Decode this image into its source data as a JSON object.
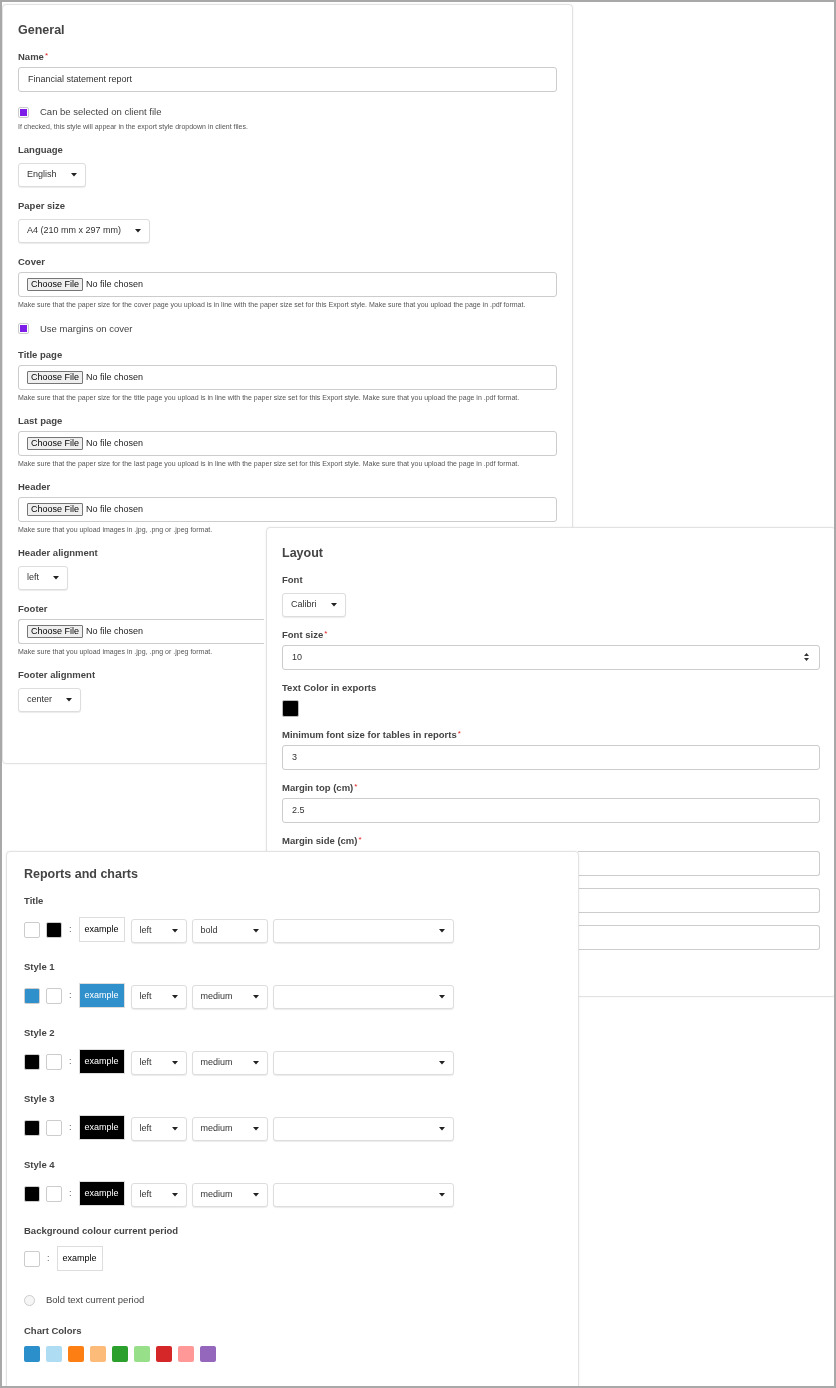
{
  "general": {
    "title": "General",
    "fields": [
      {
        "kind": "text",
        "label": "Name",
        "marker": "*",
        "value": "Financial statement report"
      },
      {
        "kind": "checkbox",
        "label": "Can be selected on client file",
        "checked": true,
        "help": "If checked, this style will appear in the export style dropdown in client files."
      },
      {
        "kind": "select",
        "label": "Language",
        "value": "English"
      },
      {
        "kind": "select",
        "label": "Paper size",
        "value": "A4 (210 mm x 297 mm)"
      },
      {
        "kind": "file",
        "label": "Cover",
        "button": "Choose File",
        "status": "No file chosen",
        "help": "Make sure that the paper size for the cover page you upload is in line with the paper size set for this Export style. Make sure that you upload the page in .pdf format."
      },
      {
        "kind": "checkbox",
        "label": "Use margins on cover",
        "checked": true
      },
      {
        "kind": "file",
        "label": "Title page",
        "button": "Choose File",
        "status": "No file chosen",
        "help": "Make sure that the paper size for the title page you upload is in line with the paper size set for this Export style. Make sure that you upload the page in .pdf format."
      },
      {
        "kind": "file",
        "label": "Last page",
        "button": "Choose File",
        "status": "No file chosen",
        "help": "Make sure that the paper size for the last page you upload is in line with the paper size set for this Export style. Make sure that you upload the page in .pdf format."
      },
      {
        "kind": "file",
        "label": "Header",
        "button": "Choose File",
        "status": "No file chosen",
        "help": "Make sure that you upload images in .jpg, .png or .jpeg format."
      },
      {
        "kind": "select",
        "label": "Header alignment",
        "value": "left"
      },
      {
        "kind": "file",
        "label": "Footer",
        "button": "Choose File",
        "status": "No file chosen",
        "help": "Make sure that you upload images in .jpg, .png or .jpeg format."
      },
      {
        "kind": "select",
        "label": "Footer alignment",
        "value": "center"
      }
    ]
  },
  "layout": {
    "title": "Layout",
    "fields": [
      {
        "kind": "select",
        "label": "Font",
        "value": "Calibri"
      },
      {
        "kind": "number",
        "label": "Font size",
        "marker": "*",
        "value": "10"
      },
      {
        "kind": "color",
        "label": "Text Color in exports",
        "color": "#000000"
      },
      {
        "kind": "text",
        "label": "Minimum font size for tables in reports",
        "marker": "*",
        "value": "3"
      },
      {
        "kind": "text",
        "label": "Margin top (cm)",
        "marker": "*",
        "value": "2.5"
      },
      {
        "kind": "text",
        "label": "Margin side (cm)",
        "marker": "*"
      },
      {
        "kind": "text"
      },
      {
        "kind": "text"
      }
    ]
  },
  "reports": {
    "title": "Reports and charts",
    "rows": [
      {
        "kind": "style",
        "label": "Title",
        "swatches": [
          {
            "color": "#ffffff"
          },
          {
            "color": "#000000"
          }
        ],
        "separator": ":",
        "example": "example",
        "align": "left",
        "weight": "bold"
      },
      {
        "kind": "style",
        "label": "Style 1",
        "swatches": [
          {
            "color": "#3090cb"
          },
          {
            "color": "#ffffff"
          }
        ],
        "separator": ":",
        "example": "example",
        "align": "left",
        "weight": "medium"
      },
      {
        "kind": "style",
        "label": "Style 2",
        "swatches": [
          {
            "color": "#000000"
          },
          {
            "color": "#ffffff"
          }
        ],
        "separator": ":",
        "example": "example",
        "align": "left",
        "weight": "medium"
      },
      {
        "kind": "style",
        "label": "Style 3",
        "swatches": [
          {
            "color": "#000000"
          },
          {
            "color": "#ffffff"
          }
        ],
        "separator": ":",
        "example": "example",
        "align": "left",
        "weight": "medium"
      },
      {
        "kind": "style",
        "label": "Style 4",
        "swatches": [
          {
            "color": "#000000"
          },
          {
            "color": "#ffffff"
          }
        ],
        "separator": ":",
        "example": "example",
        "align": "left",
        "weight": "medium"
      },
      {
        "kind": "background",
        "label": "Background colour current period",
        "swatches": [
          {
            "color": "#ffffff"
          }
        ],
        "separator": ":",
        "example": "example"
      },
      {
        "kind": "checkbox",
        "label": "Bold text current period",
        "checked": false
      },
      {
        "kind": "palette",
        "label": "Chart Colors",
        "colors": [
          {
            "color": "#2b8fcb"
          },
          {
            "color": "#aedcf2"
          },
          {
            "color": "#fd7f13"
          },
          {
            "color": "#fdbb7a"
          },
          {
            "color": "#2ca02c"
          },
          {
            "color": "#98df8a"
          },
          {
            "color": "#d62728"
          },
          {
            "color": "#ff9896"
          },
          {
            "color": "#9467bd"
          }
        ]
      }
    ]
  }
}
